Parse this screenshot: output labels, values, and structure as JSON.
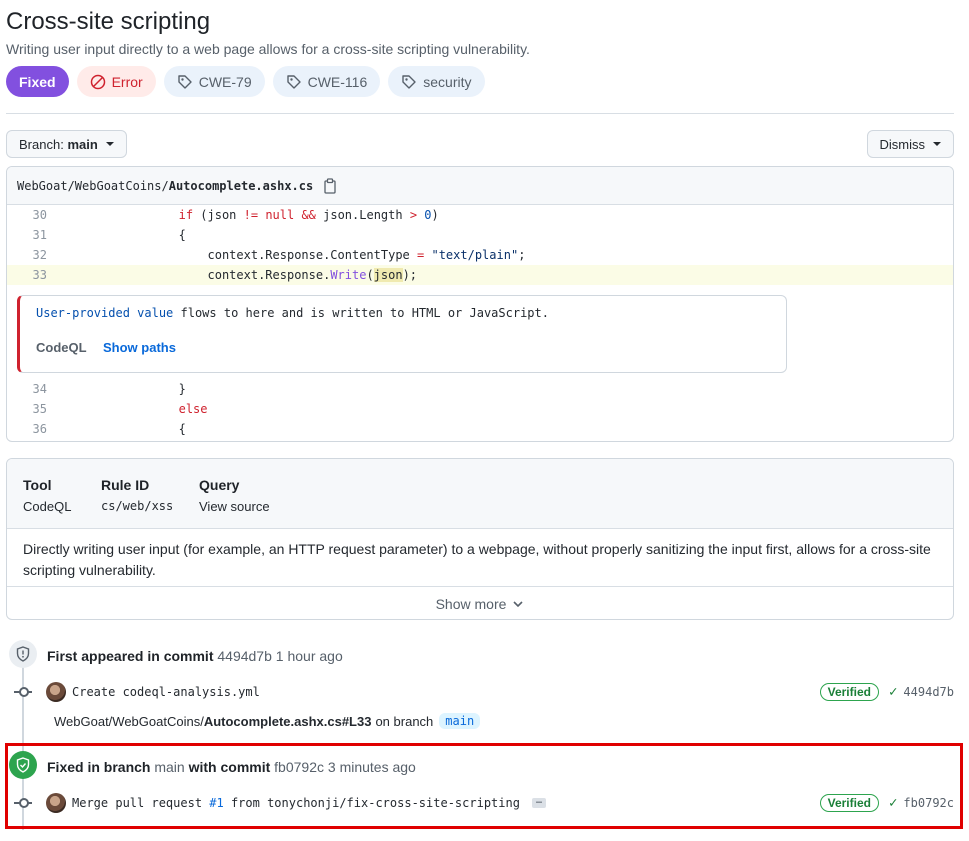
{
  "header": {
    "title": "Cross-site scripting",
    "subtitle": "Writing user input directly to a web page allows for a cross-site scripting vulnerability."
  },
  "labels": {
    "status": "Fixed",
    "severity": "Error",
    "tags": [
      "CWE-79",
      "CWE-116",
      "security"
    ]
  },
  "toolbar": {
    "branch_prefix": "Branch:",
    "branch_value": "main",
    "dismiss_label": "Dismiss"
  },
  "code": {
    "file_prefix": "WebGoat/WebGoatCoins/",
    "file_name": "Autocomplete.ashx.cs",
    "lines_before": [
      {
        "num": "30"
      },
      {
        "num": "31"
      },
      {
        "num": "32"
      },
      {
        "num": "33"
      }
    ],
    "lines_after": [
      {
        "num": "34"
      },
      {
        "num": "35"
      },
      {
        "num": "36"
      }
    ],
    "alert": {
      "message_highlight": "User-provided value",
      "message_rest": " flows to here and is written to HTML or JavaScript.",
      "tool": "CodeQL",
      "show_paths": "Show paths"
    }
  },
  "info": {
    "tool_heading": "Tool",
    "tool_value": "CodeQL",
    "rule_heading": "Rule ID",
    "rule_value": "cs/web/xss",
    "query_heading": "Query",
    "query_value": "View source",
    "description": "Directly writing user input (for example, an HTTP request parameter) to a webpage, without properly sanitizing the input first, allows for a cross-site scripting vulnerability.",
    "show_more": "Show more"
  },
  "timeline": {
    "first": {
      "title_bold": "First appeared in commit",
      "sha": "4494d7b",
      "time": "1 hour ago",
      "commit_message": "Create codeql-analysis.yml",
      "verified": "Verified",
      "commit_sha": "4494d7b",
      "path": "WebGoat/WebGoatCoins/",
      "path_file": "Autocomplete.ashx.cs#L33",
      "on_branch": "on branch",
      "branch": "main"
    },
    "fixed": {
      "title_bold1": "Fixed in branch",
      "branch": "main",
      "title_bold2": "with commit",
      "sha": "fb0792c",
      "time": "3 minutes ago",
      "commit_prefix": "Merge pull request ",
      "pr_link": "#1",
      "commit_suffix": " from tonychonji/fix-cross-site-scripting",
      "ellipsis": "…",
      "verified": "Verified",
      "commit_sha": "fb0792c"
    }
  },
  "colors": {
    "fixed_badge": "#8250df",
    "error_text": "#cf222e",
    "verified": "#1a7f37",
    "highlight_frame": "#e00000"
  }
}
